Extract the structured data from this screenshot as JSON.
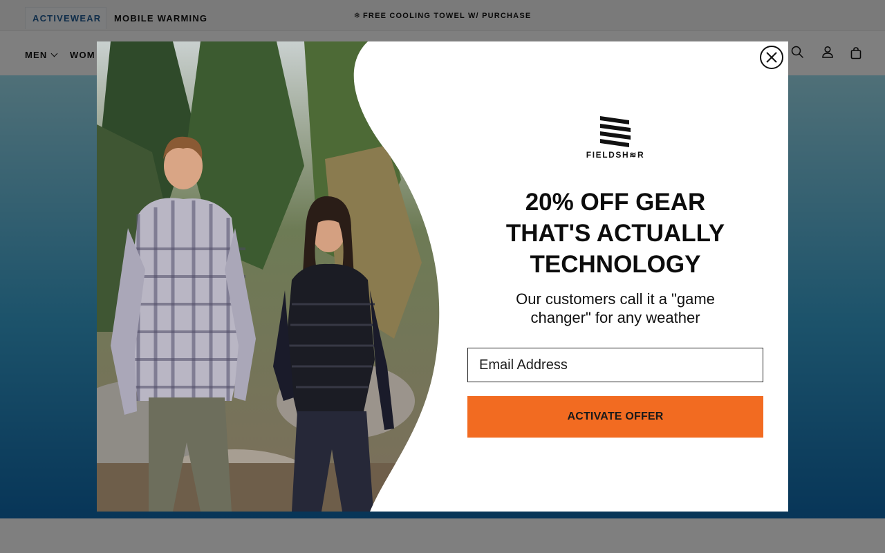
{
  "topbar": {
    "segments": [
      {
        "label": "ACTIVEWEAR"
      },
      {
        "label": "MOBILE WARMING"
      }
    ],
    "promo_icon": "❄",
    "promo_text": "FREE COOLING TOWEL W/ PURCHASE"
  },
  "nav": {
    "items": [
      {
        "label": "MEN"
      },
      {
        "label": "WOM"
      }
    ],
    "icons": [
      "search-icon",
      "account-icon",
      "bag-icon"
    ]
  },
  "popup": {
    "logo_text": "FIELDSH≋R",
    "headline": "20% OFF GEAR THAT'S ACTUALLY TECHNOLOGY",
    "subheadline": "Our customers call it a \"game changer\" for any weather",
    "email_placeholder": "Email Address",
    "cta_label": "ACTIVATE OFFER",
    "close_icon": "close-icon"
  },
  "colors": {
    "accent_orange": "#f26b21",
    "topbar_active_text": "#1f5b94",
    "hero_blue": "#0f6bb0"
  }
}
